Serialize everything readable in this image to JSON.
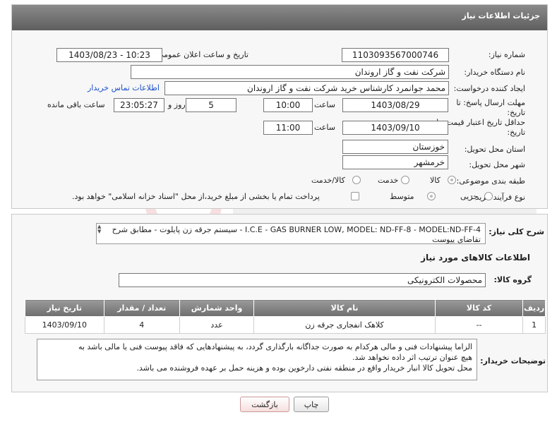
{
  "header": {
    "title": "جزئیات اطلاعات نیاز"
  },
  "form": {
    "need_number_label": "شماره نیاز:",
    "need_number": "1103093567000746",
    "announce_datetime_label": "تاریخ و ساعت اعلان عمومی:",
    "announce_datetime": "1403/08/23 - 10:23",
    "buyer_org_label": "نام دستگاه خریدار:",
    "buyer_org": "شرکت نفت و گاز اروندان",
    "requester_label": "ایجاد کننده درخواست:",
    "requester": "محمد جوانمرد کارشناس خرید شرکت نفت و گاز اروندان",
    "contact_link": "اطلاعات تماس خریدار",
    "reply_deadline_label_1": "مهلت ارسال پاسخ: تا",
    "reply_deadline_label_2": "تاریخ:",
    "reply_date": "1403/08/29",
    "time_label": "ساعت",
    "reply_time": "10:00",
    "days_value": "5",
    "days_label": "روز و",
    "remaining_time": "23:05:27",
    "remaining_label": "ساعت باقی مانده",
    "validity_label_1": "حداقل تاریخ اعتبار قیمت: تا",
    "validity_label_2": "تاریخ:",
    "validity_date": "1403/09/10",
    "validity_time": "11:00",
    "province_label": "استان محل تحویل:",
    "province": "خوزستان",
    "city_label": "شهر محل تحویل:",
    "city": "خرمشهر",
    "category_label": "طبقه بندی موضوعی:",
    "category_options": [
      "کالا",
      "خدمت",
      "کالا/خدمت"
    ],
    "category_selected": "کالا",
    "process_label": "نوع فرآیند خرید :",
    "process_options": [
      "جزیی",
      "متوسط"
    ],
    "process_selected": "متوسط",
    "payment_note": "پرداخت تمام یا بخشی از مبلغ خرید،از محل \"اسناد خزانه اسلامی\" خواهد بود."
  },
  "description": {
    "label": "شرح کلی نیاز:",
    "text": "I.C.E - GAS BURNER LOW,  MODEL: ND-FF-8 - MODEL:ND-FF-4 - سیستم جرقه زن پایلوت -  مطابق شرح تقاضای پیوست"
  },
  "goods": {
    "section_title": "اطلاعات کالاهای مورد نیاز",
    "group_label": "گروه کالا:",
    "group_value": "محصولات الکترونیکی",
    "columns": [
      "ردیف",
      "کد کالا",
      "نام کالا",
      "واحد شمارش",
      "تعداد / مقدار",
      "تاریخ نیاز"
    ],
    "rows": [
      {
        "row": "1",
        "code": "--",
        "name": "کلاهک انفجاری جرقه زن",
        "unit": "عدد",
        "qty": "4",
        "date": "1403/09/10"
      }
    ]
  },
  "buyer_notes": {
    "label": "توضیحات خریدار:",
    "lines": [
      "الزاما پیشنهادات فنی و مالی هرکدام به صورت جداگانه بارگذاری گردد، به پیشنهادهایی که فاقد پیوست فنی یا مالی باشد به",
      "هیچ عنوان ترتیب اثر داده نخواهد شد.",
      "محل تحویل کالا انبار خریدار واقع در منطقه نفتی دارخوین بوده و هزینه حمل بر عهده فروشنده می باشد."
    ]
  },
  "buttons": {
    "print": "چاپ",
    "back": "بازگشت"
  },
  "colors": {
    "header_bar": "#6e6e6e",
    "link": "#1a4fc7",
    "back_button": "#f6dede"
  }
}
